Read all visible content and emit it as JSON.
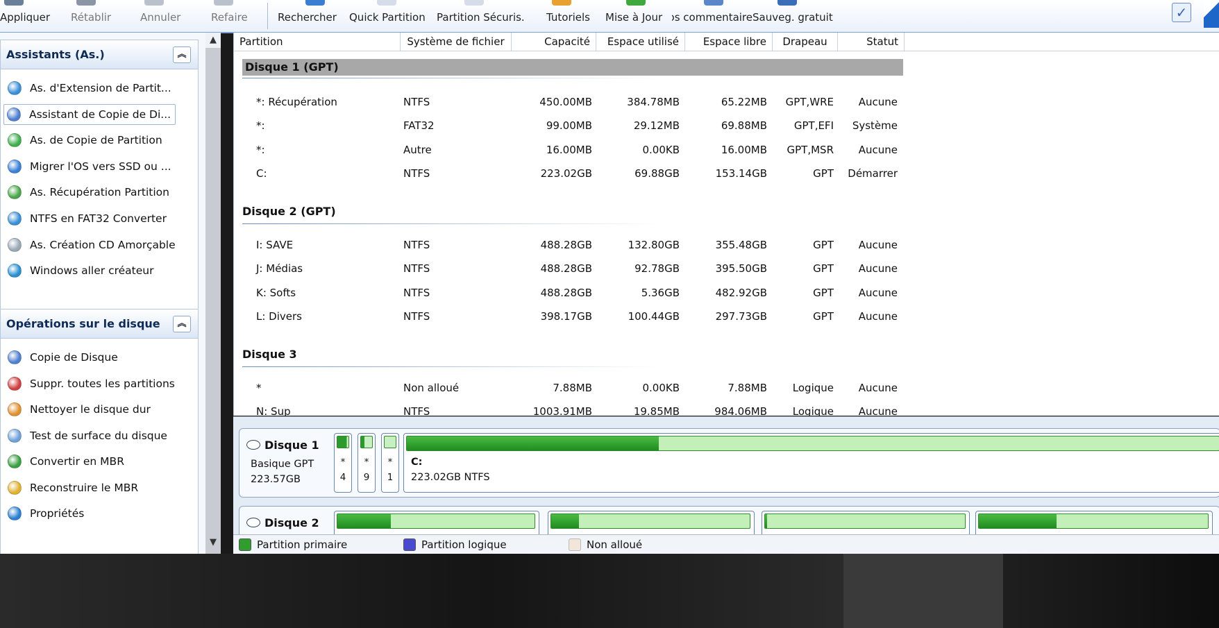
{
  "toolbar": {
    "buttons": [
      {
        "label": "Appliquer",
        "icon": "apply-icon"
      },
      {
        "label": "Rétablir",
        "icon": "undo-icon"
      },
      {
        "label": "Annuler",
        "icon": "cancel-icon"
      },
      {
        "label": "Refaire",
        "icon": "redo-icon"
      },
      {
        "label": "Rechercher",
        "icon": "search-icon"
      },
      {
        "label": "Quick Partition",
        "icon": "quick-partition-icon"
      },
      {
        "label": "Partition Sécuris.",
        "icon": "secure-partition-icon"
      },
      {
        "label": "Tutoriels",
        "icon": "tutorial-icon"
      },
      {
        "label": "Mise à Jour",
        "icon": "update-icon"
      },
      {
        "label": "os commentaire",
        "icon": "feedback-icon"
      },
      {
        "label": "Sauveg. gratuit",
        "icon": "backup-icon"
      }
    ]
  },
  "sidebar": {
    "wizards": {
      "title": "Assistants (As.)",
      "items": [
        {
          "label": "As. d'Extension de Partit...",
          "icon": "extend-partition-icon",
          "color": "#3a8fd6"
        },
        {
          "label": "Assistant de Copie de Di...",
          "icon": "copy-disk-icon",
          "color": "#4f7fd0"
        },
        {
          "label": "As. de Copie de Partition",
          "icon": "copy-partition-icon",
          "color": "#3fae4d"
        },
        {
          "label": "Migrer l'OS vers SSD ou ...",
          "icon": "migrate-os-icon",
          "color": "#3a7fd8"
        },
        {
          "label": "As. Récupération Partition",
          "icon": "recover-partition-icon",
          "color": "#4aa64a"
        },
        {
          "label": "NTFS en FAT32 Converter",
          "icon": "convert-fs-icon",
          "color": "#3a8fd6"
        },
        {
          "label": "As. Création CD Amorçable",
          "icon": "bootable-cd-icon",
          "color": "#9aa7b5"
        },
        {
          "label": "Windows aller créateur",
          "icon": "windows-to-go-icon",
          "color": "#2a8fd0"
        }
      ]
    },
    "disk_ops": {
      "title": "Opérations sur le disque",
      "items": [
        {
          "label": "Copie de Disque",
          "icon": "copy-disk-icon",
          "color": "#4f7fd0"
        },
        {
          "label": "Suppr. toutes les partitions",
          "icon": "delete-all-icon",
          "color": "#d04040"
        },
        {
          "label": "Nettoyer le disque dur",
          "icon": "wipe-disk-icon",
          "color": "#e09030"
        },
        {
          "label": "Test de surface du disque",
          "icon": "surface-test-icon",
          "color": "#6fa0d8"
        },
        {
          "label": "Convertir en MBR",
          "icon": "convert-mbr-icon",
          "color": "#3aa040"
        },
        {
          "label": "Reconstruire le MBR",
          "icon": "rebuild-mbr-icon",
          "color": "#e0b030"
        },
        {
          "label": "Propriétés",
          "icon": "properties-icon",
          "color": "#2a7fd0"
        }
      ]
    }
  },
  "table": {
    "columns": [
      "Partition",
      "Système de fichier",
      "Capacité",
      "Espace utilisé",
      "Espace libre",
      "Drapeau",
      "Statut"
    ],
    "disks": [
      {
        "name": "Disque 1 (GPT)",
        "rows": [
          [
            "*: Récupération",
            "NTFS",
            "450.00MB",
            "384.78MB",
            "65.22MB",
            "GPT,WRE",
            "Aucune"
          ],
          [
            "*:",
            "FAT32",
            "99.00MB",
            "29.12MB",
            "69.88MB",
            "GPT,EFI",
            "Système"
          ],
          [
            "*:",
            "Autre",
            "16.00MB",
            "0.00KB",
            "16.00MB",
            "GPT,MSR",
            "Aucune"
          ],
          [
            "C:",
            "NTFS",
            "223.02GB",
            "69.88GB",
            "153.14GB",
            "GPT",
            "Démarrer"
          ]
        ]
      },
      {
        "name": "Disque 2 (GPT)",
        "rows": [
          [
            "I: SAVE",
            "NTFS",
            "488.28GB",
            "132.80GB",
            "355.48GB",
            "GPT",
            "Aucune"
          ],
          [
            "J: Médias",
            "NTFS",
            "488.28GB",
            "92.78GB",
            "395.50GB",
            "GPT",
            "Aucune"
          ],
          [
            "K: Softs",
            "NTFS",
            "488.28GB",
            "5.36GB",
            "482.92GB",
            "GPT",
            "Aucune"
          ],
          [
            "L: Divers",
            "NTFS",
            "398.17GB",
            "100.44GB",
            "297.73GB",
            "GPT",
            "Aucune"
          ]
        ]
      },
      {
        "name": "Disque 3",
        "rows": [
          [
            "*",
            "Non alloué",
            "7.88MB",
            "0.00KB",
            "7.88MB",
            "Logique",
            "Aucune"
          ],
          [
            "N: Sup",
            "NTFS",
            "1003.91MB",
            "19.85MB",
            "984.06MB",
            "Logique",
            "Aucune"
          ]
        ]
      }
    ]
  },
  "diskmap": {
    "disk1": {
      "name": "Disque 1",
      "type": "Basique GPT",
      "size": "223.57GB",
      "small": [
        {
          "star": "*",
          "num": "4",
          "used": 0.85
        },
        {
          "star": "*",
          "num": "9",
          "used": 0.3
        },
        {
          "star": "*",
          "num": "1",
          "used": 0.0
        }
      ],
      "main_label": "C:",
      "main_desc": "223.02GB NTFS",
      "main_used": 0.31
    },
    "disk2": {
      "name": "Disque 2",
      "parts_used": [
        0.27,
        0.14,
        0.01,
        0.34
      ]
    }
  },
  "legend": {
    "primary": "Partition primaire",
    "logical": "Partition logique",
    "unallocated": "Non alloué",
    "primary_color": "#2f9e2f",
    "logical_color": "#4a4ad0",
    "unallocated_color": "#f2e6da"
  }
}
